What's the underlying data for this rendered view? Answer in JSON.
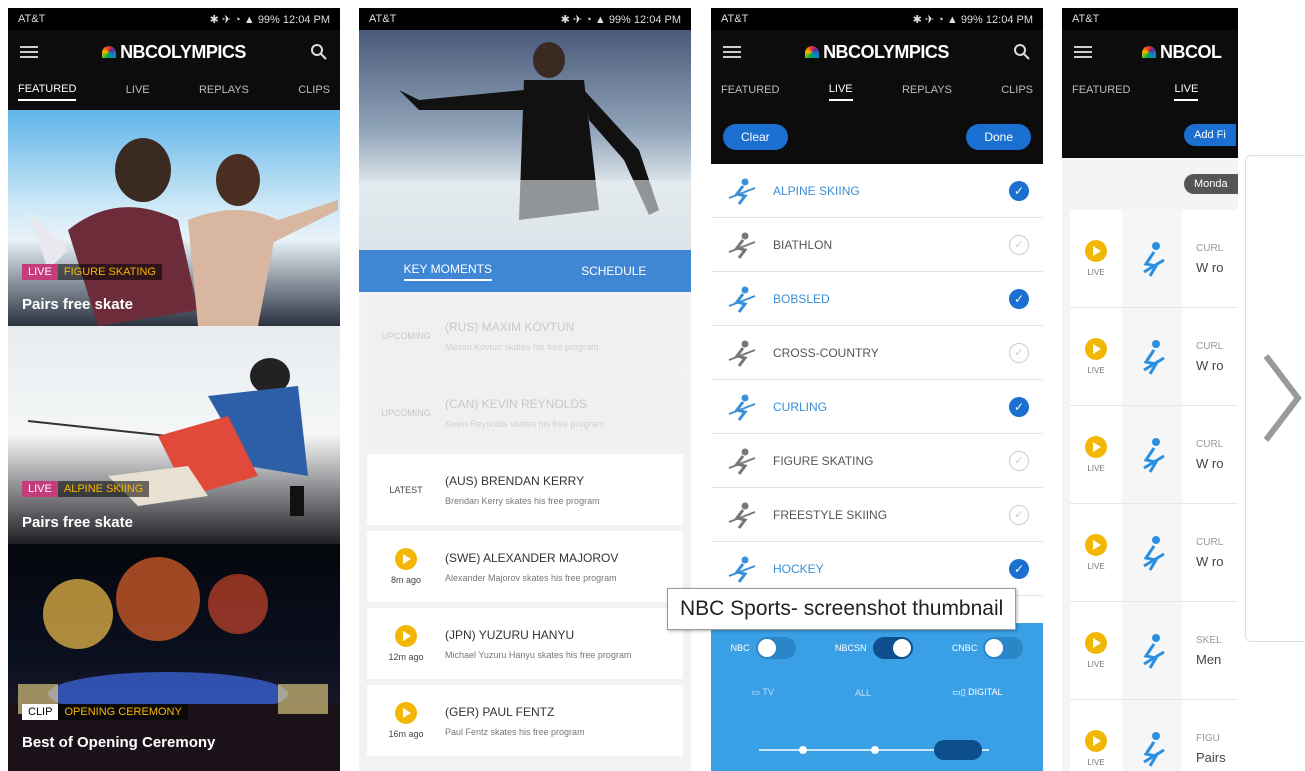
{
  "status": {
    "carrier": "AT&T",
    "icons": "✱ ✈ ◔ ▲ 99%",
    "time": "12:04 PM"
  },
  "app": {
    "logo": "NBCOLYMPICS",
    "logo_short": "NBCOL"
  },
  "tabs": [
    "FEATURED",
    "LIVE",
    "REPLAYS",
    "CLIPS"
  ],
  "screen1": {
    "cards": [
      {
        "badge1": "LIVE",
        "badge2": "FIGURE SKATING",
        "title": "Pairs free skate"
      },
      {
        "badge1": "LIVE",
        "badge2": "ALPINE SKIING",
        "title": "Pairs free skate"
      },
      {
        "badge1": "CLIP",
        "badge2": "OPENING CEREMONY",
        "title": "Best of Opening Ceremony"
      }
    ]
  },
  "screen2": {
    "subtabs": [
      "KEY MOMENTS",
      "SCHEDULE"
    ],
    "moments": [
      {
        "status": "UPCOMING",
        "time": "",
        "name": "(RUS) MAXIM KOVTUN",
        "desc": "Maxim Kovtun skates his free program",
        "dim": true
      },
      {
        "status": "UPCOMING",
        "time": "",
        "name": "(CAN) KEVIN REYNOLDS",
        "desc": "Kevin Reynolds skates his free program",
        "dim": true
      },
      {
        "status": "LATEST",
        "time": "",
        "name": "(AUS) BRENDAN KERRY",
        "desc": "Brendan Kerry skates his free program",
        "dim": false
      },
      {
        "status": "",
        "time": "8m ago",
        "name": "(SWE) ALEXANDER MAJOROV",
        "desc": "Alexander Majorov skates his free program",
        "dim": false
      },
      {
        "status": "",
        "time": "12m ago",
        "name": "(JPN) YUZURU HANYU",
        "desc": "Michael Yuzuru Hanyu skates his free program",
        "dim": false
      },
      {
        "status": "",
        "time": "16m ago",
        "name": "(GER) PAUL FENTZ",
        "desc": "Paul Fentz skates his free program",
        "dim": false
      }
    ]
  },
  "screen3": {
    "clear": "Clear",
    "done": "Done",
    "sports": [
      {
        "name": "ALPINE SKIING",
        "checked": true
      },
      {
        "name": "BIATHLON",
        "checked": false
      },
      {
        "name": "BOBSLED",
        "checked": true
      },
      {
        "name": "CROSS-COUNTRY",
        "checked": false
      },
      {
        "name": "CURLING",
        "checked": true
      },
      {
        "name": "FIGURE SKATING",
        "checked": false
      },
      {
        "name": "FREESTYLE SKIING",
        "checked": false
      },
      {
        "name": "HOCKEY",
        "checked": true
      }
    ],
    "toggles": [
      "NBC",
      "NBCSN",
      "CNBC"
    ],
    "devices": [
      "TV",
      "ALL",
      "DIGITAL"
    ]
  },
  "screen4": {
    "add_button": "Add Fi",
    "day_chip": "Monda",
    "live_label": "LIVE",
    "rows": [
      {
        "sport": "CURL",
        "title": "W ro"
      },
      {
        "sport": "CURL",
        "title": "W ro"
      },
      {
        "sport": "CURL",
        "title": "W ro"
      },
      {
        "sport": "CURL",
        "title": "W ro"
      },
      {
        "sport": "SKEL",
        "title": "Men"
      },
      {
        "sport": "FIGU",
        "title": "Pairs"
      }
    ]
  },
  "tooltip": "NBC Sports- screenshot thumbnail",
  "colors": {
    "accent": "#1a6fd0",
    "live_badge": "#c43c7c",
    "play": "#f2b705",
    "filter_blue": "#3aa0e6"
  }
}
